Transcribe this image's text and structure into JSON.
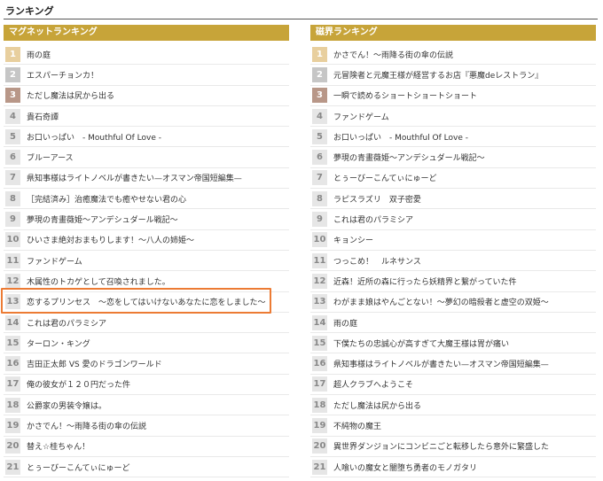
{
  "page": {
    "title": "ランキング"
  },
  "left_panel": {
    "header": "マグネットランキング",
    "items": [
      {
        "rank": "1",
        "title": "雨の庭"
      },
      {
        "rank": "2",
        "title": "エスパーチョンカ！"
      },
      {
        "rank": "3",
        "title": "ただし魔法は尻から出る"
      },
      {
        "rank": "4",
        "title": "貴石奇譚"
      },
      {
        "rank": "5",
        "title": "お口いっぱい　- Mouthful Of Love -"
      },
      {
        "rank": "6",
        "title": "ブルーアース"
      },
      {
        "rank": "7",
        "title": "県知事様はライトノベルが書きたい—オスマン帝国短編集—"
      },
      {
        "rank": "8",
        "title": "［完結済み］治癒魔法でも癒やせない君の心"
      },
      {
        "rank": "9",
        "title": "夢現の青畫薇姫〜アンデシュダール戦記〜"
      },
      {
        "rank": "10",
        "title": "ひいさま絶対おまもりします！〜八人の姉姫〜"
      },
      {
        "rank": "11",
        "title": "ファンドゲーム"
      },
      {
        "rank": "12",
        "title": "木属性のトカゲとして召喚されました。"
      },
      {
        "rank": "13",
        "title": "恋するプリンセス　〜恋をしてはいけないあなたに恋をしました〜"
      },
      {
        "rank": "14",
        "title": "これは君のパラミシア"
      },
      {
        "rank": "15",
        "title": "ターロン・キング"
      },
      {
        "rank": "16",
        "title": "吉田正太郎 VS 愛のドラゴンワールド"
      },
      {
        "rank": "17",
        "title": "俺の彼女が１２０円だった件"
      },
      {
        "rank": "18",
        "title": "公爵家の男装令嬢は。"
      },
      {
        "rank": "19",
        "title": "かさでん！〜雨降る街の傘の伝説"
      },
      {
        "rank": "20",
        "title": "替え☆桂ちゃん！"
      },
      {
        "rank": "21",
        "title": "とぅーびーこんてぃにゅーど"
      }
    ]
  },
  "right_panel": {
    "header": "磁界ランキング",
    "items": [
      {
        "rank": "1",
        "title": "かさでん！〜雨降る街の傘の伝説"
      },
      {
        "rank": "2",
        "title": "元冒険者と元魔王様が経営するお店『悪魔deレストラン』"
      },
      {
        "rank": "3",
        "title": "一瞬で読めるショートショートショート"
      },
      {
        "rank": "4",
        "title": "ファンドゲーム"
      },
      {
        "rank": "5",
        "title": "お口いっぱい　- Mouthful Of Love -"
      },
      {
        "rank": "6",
        "title": "夢現の青畫薇姫〜アンデシュダール戦記〜"
      },
      {
        "rank": "7",
        "title": "とぅーびーこんてぃにゅーど"
      },
      {
        "rank": "8",
        "title": "ラピスラズリ　双子密愛"
      },
      {
        "rank": "9",
        "title": "これは君のパラミシア"
      },
      {
        "rank": "10",
        "title": "キョンシー"
      },
      {
        "rank": "11",
        "title": "つっこめ！　ルネサンス"
      },
      {
        "rank": "12",
        "title": "近森！近所の森に行ったら妖精界と繋がっていた件"
      },
      {
        "rank": "13",
        "title": "わがまま娘はやんごとない！〜夢幻の暗殺者と虚空の双姫〜"
      },
      {
        "rank": "14",
        "title": "雨の庭"
      },
      {
        "rank": "15",
        "title": "下僕たちの忠誠心が高すぎて大魔王様は胃が痛い"
      },
      {
        "rank": "16",
        "title": "県知事様はライトノベルが書きたい—オスマン帝国短編集—"
      },
      {
        "rank": "17",
        "title": "超人クラブへようこそ"
      },
      {
        "rank": "18",
        "title": "ただし魔法は尻から出る"
      },
      {
        "rank": "19",
        "title": "不純物の魔王"
      },
      {
        "rank": "20",
        "title": "異世界ダンジョンにコンビニごと転移したら意外に繁盛した"
      },
      {
        "rank": "21",
        "title": "人喰いの魔女と闇堕ち勇者のモノガタリ"
      }
    ]
  },
  "colors": {
    "header_bg": "#c7a439",
    "rank1": "#e8cf9e",
    "rank2": "#c6c6c6",
    "rank3": "#b89788",
    "rank_default": "#e6e6e6",
    "highlight": "#ec7b34"
  }
}
